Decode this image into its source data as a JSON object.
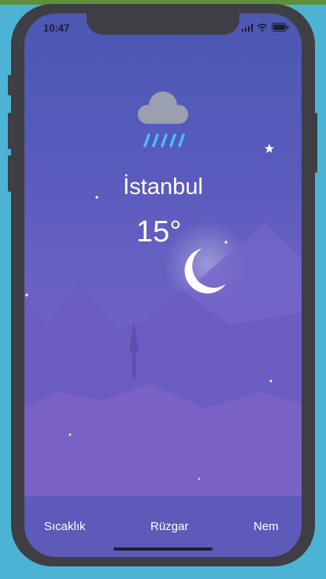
{
  "status_bar": {
    "time": "10:47"
  },
  "weather": {
    "city": "İstanbul",
    "temperature": "15°",
    "condition_icon": "rain-cloud-icon",
    "scene_icon": "crescent-moon-icon"
  },
  "tabs": [
    {
      "label": "Sıcaklık"
    },
    {
      "label": "Rüzgar"
    },
    {
      "label": "Nem"
    }
  ],
  "colors": {
    "background": "#4cb3d4",
    "device_frame": "#3e3e44",
    "sky_top": "#4b58b2",
    "sky_bottom": "#7962c5",
    "tab_bar": "#5d5ab9",
    "rain": "#4fb9ff"
  }
}
